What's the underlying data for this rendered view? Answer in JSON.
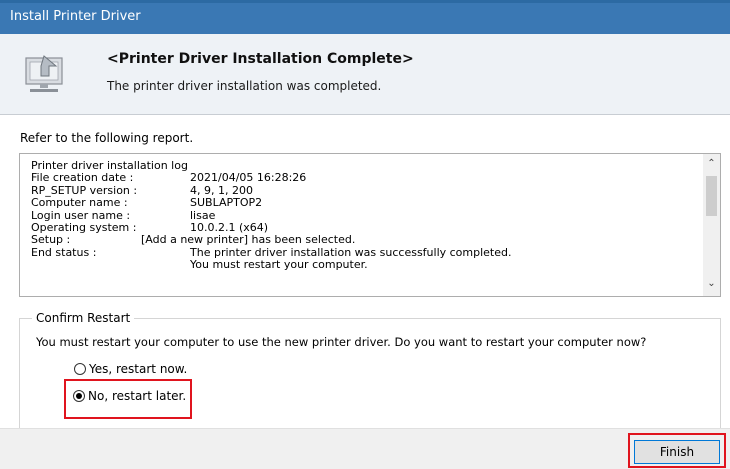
{
  "window": {
    "title": "Install Printer Driver"
  },
  "header": {
    "title": "<Printer Driver Installation Complete>",
    "subtitle": "The printer driver installation was completed.",
    "icon": "computer-install-icon"
  },
  "refer_text": "Refer to the following report.",
  "log": {
    "heading": "Printer driver installation log",
    "rows": [
      {
        "key": "File creation date :",
        "value": "2021/04/05 16:28:26"
      },
      {
        "key": "RP_SETUP version :",
        "value": "4, 9, 1, 200"
      },
      {
        "key": "Computer name :",
        "value": "SUBLAPTOP2"
      },
      {
        "key": "Login user name :",
        "value": "lisae"
      },
      {
        "key": "Operating system :",
        "value": "10.0.2.1 (x64)"
      }
    ],
    "setup": {
      "key": "Setup :",
      "value": "[Add a new printer] has been selected."
    },
    "end_status": {
      "key": "End status :",
      "value1": "The printer driver installation was successfully completed.",
      "value2": "You must restart your computer."
    }
  },
  "restart": {
    "legend": "Confirm Restart",
    "message": "You must restart your computer to use the new printer driver. Do you want to restart your computer now?",
    "options": [
      {
        "label": "Yes, restart now.",
        "selected": false
      },
      {
        "label": "No, restart later.",
        "selected": true
      }
    ]
  },
  "footer": {
    "finish_label": "Finish"
  },
  "colors": {
    "titlebar": "#3a78b4",
    "header_bg": "#eef2f6",
    "highlight": "#e0141e",
    "button_border": "#0078d7"
  }
}
